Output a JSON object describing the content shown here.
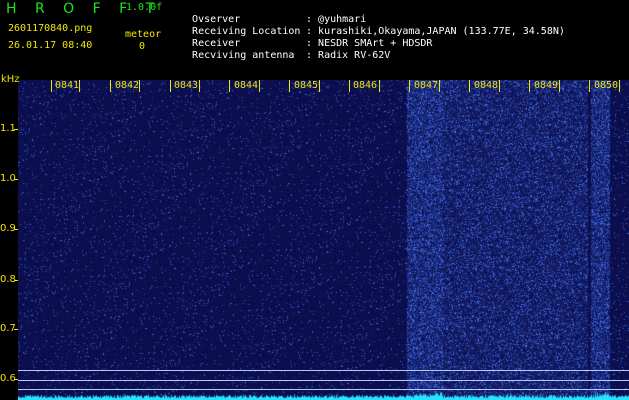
{
  "header": {
    "app_title": "H R O F F T",
    "app_version": "1.0.0f",
    "filename": "2601170840.png",
    "datetime": "26.01.17 08:40",
    "meteor_label": "meteor",
    "meteor_count": "0"
  },
  "info": [
    {
      "label": "Ovserver",
      "value": "@yuhmari"
    },
    {
      "label": "Receiving Location",
      "value": "kurashiki,Okayama,JAPAN (133.77E, 34.58N)"
    },
    {
      "label": "Receiver",
      "value": "NESDR SMArt + HDSDR"
    },
    {
      "label": "Recviving antenna",
      "value": "Radix RV-62V"
    }
  ],
  "separator": ":",
  "axis": {
    "unit": "kHz",
    "y_ticks": [
      "1.1",
      "1.0",
      "0.9",
      "0.8",
      "0.7",
      "0.6"
    ],
    "time_ticks": [
      "0841",
      "0842",
      "0843",
      "0844",
      "0845",
      "0846",
      "0847",
      "0848",
      "0849",
      "0850"
    ]
  },
  "colors": {
    "background": "#000000",
    "spectrogram_base": "#0a0b47",
    "noise_dot": "#3a5cff",
    "title_green": "#19e619",
    "label_yellow": "#f2e600",
    "baseline_cyan": "#27e3ff"
  }
}
